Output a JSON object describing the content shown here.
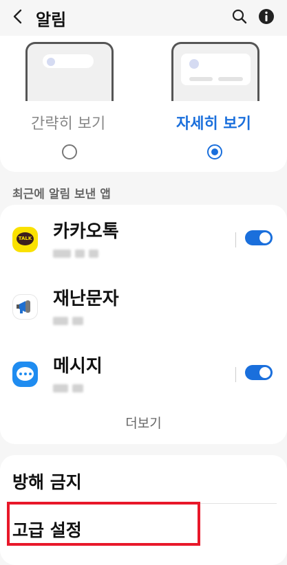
{
  "header": {
    "title": "알림",
    "icons": [
      "back-arrow-icon",
      "search-icon",
      "info-icon"
    ]
  },
  "style_selector": {
    "brief_label": "간략히 보기",
    "detail_label": "자세히 보기",
    "selected": "detail"
  },
  "recent_section": {
    "label": "최근에 알림 보낸 앱",
    "apps": [
      {
        "name": "카카오톡",
        "toggle_on": true,
        "icon_text": "TALK"
      },
      {
        "name": "재난문자",
        "toggle_on": null
      },
      {
        "name": "메시지",
        "toggle_on": true
      }
    ],
    "more_label": "더보기"
  },
  "settings": {
    "dnd_label": "방해 금지",
    "advanced_label": "고급 설정"
  },
  "colors": {
    "accent": "#1a6fdc",
    "highlight": "#e8182a",
    "kakao": "#fae100",
    "messages": "#1f8cf0"
  }
}
